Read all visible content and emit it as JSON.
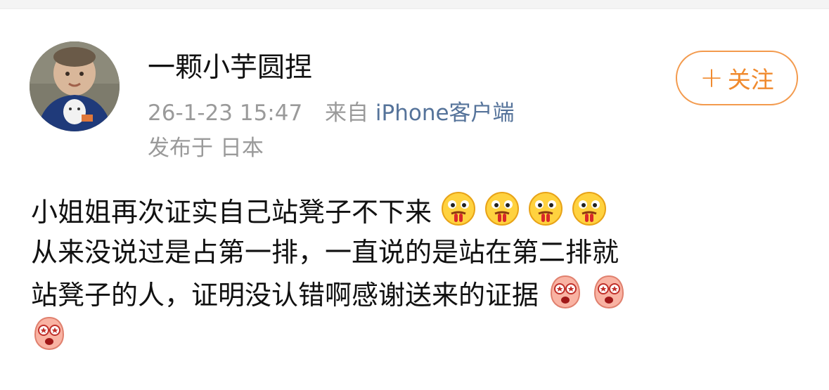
{
  "user": {
    "name": "一颗小芋圆捏",
    "time": "26-1-23 15:47",
    "source_prefix": "来自",
    "source_device": "iPhone客户端",
    "location": "发布于 日本"
  },
  "follow": {
    "plus": "+",
    "label": "关注"
  },
  "post": {
    "line1": "小姐姐再次证实自己站凳子不下来",
    "line2": "从来没说过是占第一排，一直说的是站在第二排就",
    "line3": "站凳子的人，证明没认错啊感谢送来的证据",
    "emoji_line1": [
      "drooling-face-emoji",
      "drooling-face-emoji",
      "drooling-face-emoji",
      "drooling-face-emoji"
    ],
    "emoji_line3": [
      "heart-eyes-pink-emoji",
      "heart-eyes-pink-emoji"
    ],
    "emoji_line4": [
      "heart-eyes-pink-emoji"
    ]
  },
  "colors": {
    "accent": "#f08a2e",
    "source_link": "#55739a",
    "meta_gray": "#9a9a9a",
    "text": "#111111"
  }
}
